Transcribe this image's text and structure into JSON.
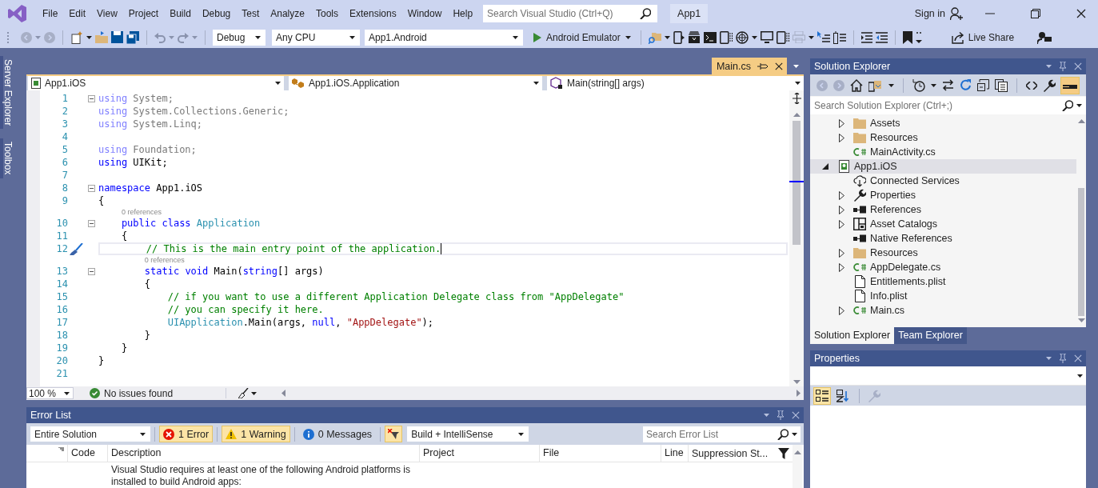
{
  "title_bar": {
    "menu": [
      "File",
      "Edit",
      "View",
      "Project",
      "Build",
      "Debug",
      "Test",
      "Analyze",
      "Tools",
      "Extensions",
      "Window",
      "Help"
    ],
    "search": {
      "placeholder": "Search Visual Studio (Ctrl+Q)"
    },
    "solution_name": "App1",
    "sign_in": "Sign in"
  },
  "toolbar": {
    "configuration": "Debug",
    "platform": "Any CPU",
    "startup_project": "App1.Android",
    "run_target": "Android Emulator",
    "live_share": "Live Share"
  },
  "side_tabs": [
    "Server Explorer",
    "Toolbox"
  ],
  "editor": {
    "tabs": [
      {
        "label": "Main.cs",
        "selected": true
      }
    ],
    "nav": [
      "App1.iOS",
      "App1.iOS.Application",
      "Main(string[] args)"
    ],
    "lines": [
      {
        "kind": "code",
        "number": "1",
        "fold": true,
        "faded": true,
        "current": false,
        "tokens": [
          {
            "kind": "keyword",
            "text": "using"
          },
          {
            "kind": "plain",
            "text": " System;"
          }
        ]
      },
      {
        "kind": "code",
        "number": "2",
        "fold": false,
        "faded": true,
        "current": false,
        "tokens": [
          {
            "kind": "keyword",
            "text": "using"
          },
          {
            "kind": "plain",
            "text": " System.Collections.Generic;"
          }
        ]
      },
      {
        "kind": "code",
        "number": "3",
        "fold": false,
        "faded": true,
        "current": false,
        "tokens": [
          {
            "kind": "keyword",
            "text": "using"
          },
          {
            "kind": "plain",
            "text": " System.Linq;"
          }
        ]
      },
      {
        "kind": "code",
        "number": "4"
      },
      {
        "kind": "code",
        "number": "5",
        "fold": false,
        "faded": true,
        "current": false,
        "tokens": [
          {
            "kind": "keyword",
            "text": "using"
          },
          {
            "kind": "plain",
            "text": " Foundation;"
          }
        ]
      },
      {
        "kind": "code",
        "number": "6",
        "fold": false,
        "faded": false,
        "current": false,
        "tokens": [
          {
            "kind": "keyword",
            "text": "using"
          },
          {
            "kind": "plain",
            "text": " UIKit;"
          }
        ]
      },
      {
        "kind": "code",
        "number": "7"
      },
      {
        "kind": "code",
        "number": "8",
        "fold": true,
        "faded": false,
        "current": false,
        "tokens": [
          {
            "kind": "keyword",
            "text": "namespace"
          },
          {
            "kind": "plain",
            "text": " App1.iOS"
          }
        ]
      },
      {
        "kind": "code",
        "number": "9",
        "fold": false,
        "faded": false,
        "current": false,
        "tokens": [
          {
            "kind": "plain",
            "text": "{"
          }
        ]
      },
      {
        "kind": "lens",
        "text": "    0 references"
      },
      {
        "kind": "code",
        "number": "10",
        "fold": true,
        "faded": false,
        "current": false,
        "tokens": [
          {
            "kind": "keyword",
            "text": "    public"
          },
          {
            "kind": "keyword",
            "text": " class"
          },
          {
            "kind": "type",
            "text": " Application"
          }
        ]
      },
      {
        "kind": "code",
        "number": "11",
        "fold": false,
        "faded": false,
        "current": false,
        "tokens": [
          {
            "kind": "plain",
            "text": "    {"
          }
        ]
      },
      {
        "kind": "code",
        "number": "12",
        "fold": false,
        "faded": false,
        "current": true,
        "tokens": [
          {
            "kind": "comment",
            "text": "        // This is the main entry point of the application."
          }
        ]
      },
      {
        "kind": "lens",
        "text": "        0 references"
      },
      {
        "kind": "code",
        "number": "13",
        "fold": true,
        "faded": false,
        "current": false,
        "tokens": [
          {
            "kind": "keyword",
            "text": "        static"
          },
          {
            "kind": "keyword",
            "text": " void"
          },
          {
            "kind": "plain",
            "text": " Main("
          },
          {
            "kind": "keyword",
            "text": "string"
          },
          {
            "kind": "plain",
            "text": "[] args)"
          }
        ]
      },
      {
        "kind": "code",
        "number": "14",
        "fold": false,
        "faded": false,
        "current": false,
        "tokens": [
          {
            "kind": "plain",
            "text": "        {"
          }
        ]
      },
      {
        "kind": "code",
        "number": "15",
        "fold": false,
        "faded": false,
        "current": false,
        "tokens": [
          {
            "kind": "comment",
            "text": "            // if you want to use a different Application Delegate class from \"AppDelegate\""
          }
        ]
      },
      {
        "kind": "code",
        "number": "16",
        "fold": false,
        "faded": false,
        "current": false,
        "tokens": [
          {
            "kind": "comment",
            "text": "            // you can specify it here."
          }
        ]
      },
      {
        "kind": "code",
        "number": "17",
        "fold": false,
        "faded": false,
        "current": false,
        "tokens": [
          {
            "kind": "type",
            "text": "            UIApplication"
          },
          {
            "kind": "plain",
            "text": ".Main(args, "
          },
          {
            "kind": "keyword",
            "text": "null"
          },
          {
            "kind": "plain",
            "text": ", "
          },
          {
            "kind": "string",
            "text": "\"AppDelegate\""
          },
          {
            "kind": "plain",
            "text": ");"
          }
        ]
      },
      {
        "kind": "code",
        "number": "18",
        "fold": false,
        "faded": false,
        "current": false,
        "tokens": [
          {
            "kind": "plain",
            "text": "        }"
          }
        ]
      },
      {
        "kind": "code",
        "number": "19",
        "fold": false,
        "faded": false,
        "current": false,
        "tokens": [
          {
            "kind": "plain",
            "text": "    }"
          }
        ]
      },
      {
        "kind": "code",
        "number": "20",
        "fold": false,
        "faded": false,
        "current": false,
        "tokens": [
          {
            "kind": "plain",
            "text": "}"
          }
        ]
      },
      {
        "kind": "code",
        "number": "21"
      }
    ],
    "zoom": "100 %",
    "status": "No issues found"
  },
  "solution_explorer": {
    "title": "Solution Explorer",
    "search": {
      "placeholder": "Search Solution Explorer (Ctrl+;)"
    },
    "tree": [
      {
        "children": [
          {
            "label": "Assets",
            "kind": "folder",
            "expandable": true,
            "expanded": false,
            "selected": false
          },
          {
            "label": "Resources",
            "kind": "folder",
            "expandable": true,
            "expanded": false,
            "selected": false
          },
          {
            "label": "MainActivity.cs",
            "kind": "csharp",
            "expandable": false,
            "selected": false
          }
        ]
      },
      {
        "label": "App1.iOS",
        "kind": "project",
        "expandable": true,
        "expanded": true,
        "selected": true,
        "children": [
          {
            "label": "Connected Services",
            "kind": "cloud",
            "expandable": false,
            "selected": false
          },
          {
            "label": "Properties",
            "kind": "wrench",
            "expandable": true,
            "expanded": false,
            "selected": false
          },
          {
            "label": "References",
            "kind": "refs",
            "expandable": true,
            "expanded": false,
            "selected": false
          },
          {
            "label": "Asset Catalogs",
            "kind": "catalog",
            "expandable": true,
            "expanded": false,
            "selected": false
          },
          {
            "label": "Native References",
            "kind": "refs",
            "expandable": false,
            "selected": false
          },
          {
            "label": "Resources",
            "kind": "folder",
            "expandable": true,
            "expanded": false,
            "selected": false
          },
          {
            "label": "AppDelegate.cs",
            "kind": "csharp",
            "expandable": true,
            "expanded": false,
            "selected": false
          },
          {
            "label": "Entitlements.plist",
            "kind": "file",
            "expandable": false,
            "selected": false
          },
          {
            "label": "Info.plist",
            "kind": "file",
            "expandable": false,
            "selected": false
          },
          {
            "label": "Main.cs",
            "kind": "csharp",
            "expandable": true,
            "expanded": false,
            "selected": false
          }
        ]
      }
    ],
    "tabs": [
      {
        "label": "Solution Explorer",
        "selected": true
      },
      {
        "label": "Team Explorer",
        "selected": false
      }
    ]
  },
  "properties": {
    "title": "Properties",
    "view_buttons": [
      {
        "kind": "categorized",
        "selected": true
      },
      {
        "kind": "alphabetical",
        "selected": false
      }
    ]
  },
  "error_list": {
    "title": "Error List",
    "scope": "Entire Solution",
    "filters": [
      {
        "kind": "error",
        "label": "1 Error",
        "selected": true
      },
      {
        "kind": "warning",
        "label": "1 Warning",
        "selected": true
      },
      {
        "kind": "message",
        "label": "0 Messages",
        "selected": false
      }
    ],
    "filter_toggle": {
      "selected": true
    },
    "source": "Build + IntelliSense",
    "search": {
      "placeholder": "Search Error List"
    },
    "columns": [
      "Code",
      "Description",
      "Project",
      "File",
      "Line",
      "Suppression St..."
    ],
    "rows": [
      {
        "description": "Visual Studio requires at least one of the following Android platforms is installed to build Android apps:"
      }
    ]
  }
}
